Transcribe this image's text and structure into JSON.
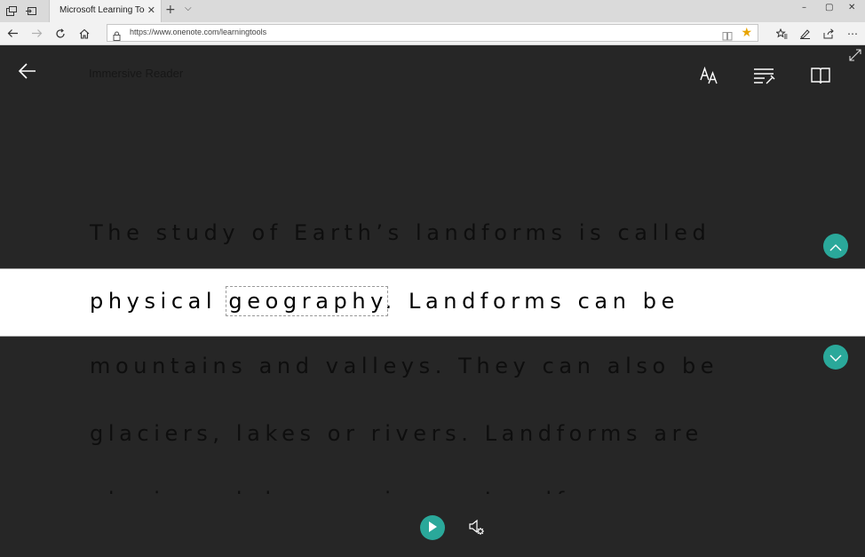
{
  "browser": {
    "tab_title": "Microsoft Learning Tool",
    "close_tab_glyph": "✕",
    "new_tab_glyph": "+",
    "tab_list_glyph": "⌵",
    "minimize_glyph": "–",
    "maximize_glyph": "▢",
    "close_window_glyph": "✕",
    "url": "https://www.onenote.com/learningtools",
    "more_glyph": "⋯"
  },
  "reader": {
    "title": "Immersive Reader",
    "lines": [
      "The study of Earth’s landforms is called",
      "mountains and valleys. They can also be",
      "glaciers, lakes or rivers. Landforms are"
    ],
    "focus_line": {
      "before": "physical ",
      "highlighted_word": "geography",
      "after": ". Landforms can be"
    }
  },
  "icons": {
    "back": "back-arrow-icon",
    "text_preferences": "text-preferences-icon",
    "grammar_options": "grammar-options-icon",
    "reading_preferences": "book-icon",
    "line_up": "chevron-up-icon",
    "line_down": "chevron-down-icon",
    "play": "play-icon",
    "voice_settings": "voice-settings-icon"
  },
  "colors": {
    "accent": "#2aa89a",
    "reader_background": "#262626",
    "star": "#e8a400"
  }
}
